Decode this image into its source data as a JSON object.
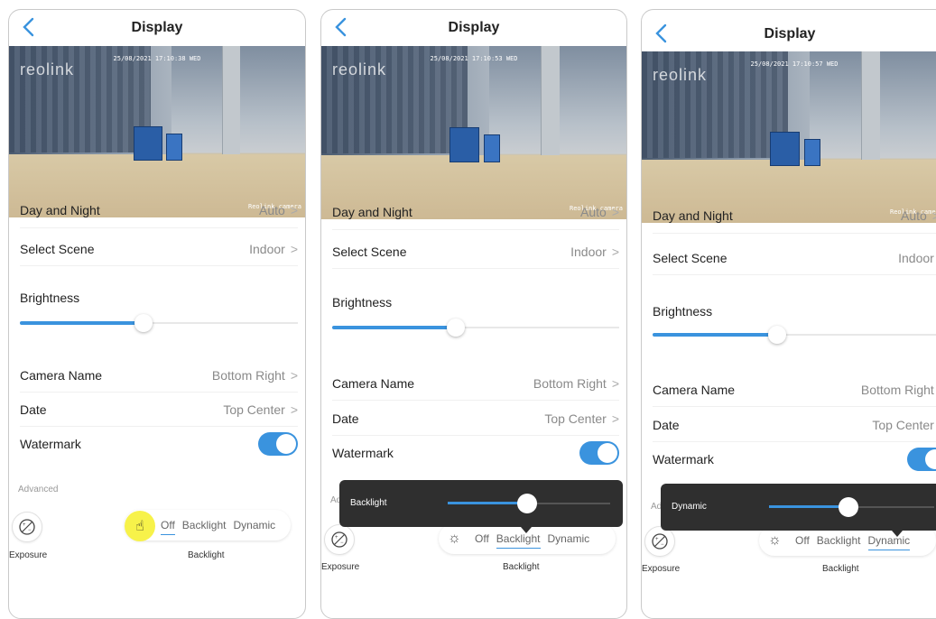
{
  "common": {
    "title": "Display",
    "camera_logo": "reolink",
    "osd_camera_name": "Reolink camera",
    "rows": {
      "day_night_label": "Day and Night",
      "day_night_value": "Auto",
      "scene_label": "Select Scene",
      "scene_value": "Indoor",
      "brightness_label": "Brightness",
      "camera_name_label": "Camera Name",
      "camera_name_value": "Bottom Right",
      "date_label": "Date",
      "date_value": "Top Center",
      "watermark_label": "Watermark"
    },
    "advanced_label": "Advanced",
    "exposure_label": "Exposure",
    "backlight_caption": "Backlight",
    "segments": [
      "Off",
      "Backlight",
      "Dynamic"
    ],
    "chevron": ">"
  },
  "screens": [
    {
      "osd_date": "25/08/2021 17:10:38 WED",
      "brightness_level": 0.45,
      "backlight_active": "Off",
      "popup": null,
      "touch_indicator": "hand-pointer-icon"
    },
    {
      "osd_date": "25/08/2021 17:10:53 WED",
      "brightness_level": 0.42,
      "backlight_active": "Backlight",
      "popup": {
        "label": "Backlight",
        "level": 0.51
      }
    },
    {
      "osd_date": "25/08/2021 17:10:57 WED",
      "brightness_level": 0.45,
      "backlight_active": "Dynamic",
      "popup": {
        "label": "Dynamic",
        "level": 0.5
      }
    }
  ],
  "colors": {
    "accent": "#3a93de",
    "popup_bg": "#2f2f2f",
    "touch": "#f7f24a"
  }
}
